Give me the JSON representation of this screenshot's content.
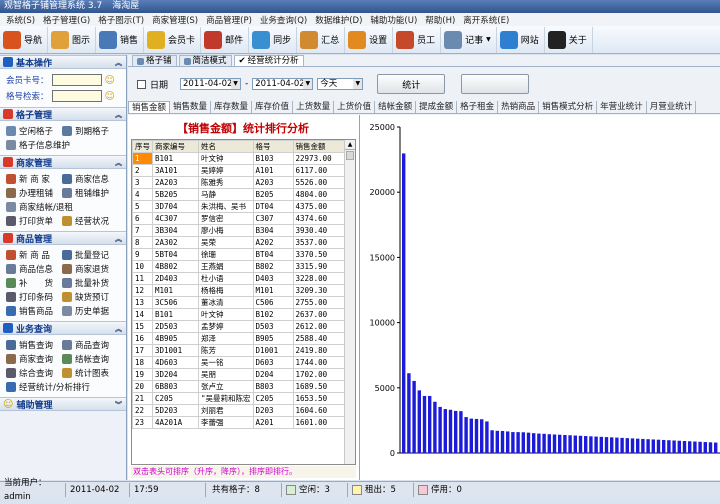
{
  "app": {
    "title": "观智格子铺管理系统 3.7",
    "user": "海淘屋"
  },
  "menu": [
    "系统(S)",
    "格子管理(G)",
    "格子图示(T)",
    "商家管理(S)",
    "商品管理(P)",
    "业务查询(Q)",
    "数据维护(D)",
    "辅助功能(U)",
    "帮助(H)",
    "离开系统(E)"
  ],
  "toolbar": [
    {
      "label": "导航",
      "icon": "home-icon",
      "color": "#d9531e"
    },
    {
      "label": "图示",
      "icon": "grid-icon",
      "color": "#e0a03a"
    },
    {
      "label": "销售",
      "icon": "cash-register-icon",
      "color": "#4a79b8"
    },
    {
      "label": "会员卡",
      "icon": "member-card-icon",
      "color": "#e0b020"
    },
    {
      "label": "邮件",
      "icon": "mail-icon",
      "color": "#c0392b"
    },
    {
      "label": "同步",
      "icon": "sync-icon",
      "color": "#3a8fd0"
    },
    {
      "label": "汇总",
      "icon": "summary-icon",
      "color": "#d08a30"
    },
    {
      "label": "设置",
      "icon": "settings-icon",
      "color": "#e08a20"
    },
    {
      "label": "员工",
      "icon": "staff-icon",
      "color": "#c44a2a"
    },
    {
      "label": "记事",
      "icon": "notes-icon",
      "color": "#6a8ab0"
    },
    {
      "label": "网站",
      "icon": "globe-icon",
      "color": "#2f7fd0"
    },
    {
      "label": "关于",
      "icon": "about-icon",
      "color": "#222222"
    }
  ],
  "sidebar": {
    "basic": {
      "title": "基本操作",
      "member_label": "会员卡号：",
      "grid_label": "格号检索："
    },
    "grid_mgmt": {
      "title": "格子管理",
      "items": [
        "空闲格子",
        "到期格子",
        "格子信息维护"
      ]
    },
    "merchant_mgmt": {
      "title": "商家管理",
      "items": [
        "新 商 家",
        "商家信息",
        "办理租铺",
        "租铺维护",
        "商家结帐/退租",
        "打印货单",
        "经营状况"
      ]
    },
    "product_mgmt": {
      "title": "商品管理",
      "items": [
        "新 商 品",
        "批量登记",
        "商品信息",
        "商家退货",
        "补　　货",
        "批量补货",
        "打印条码",
        "缺货预订",
        "销售商品",
        "历史单据"
      ]
    },
    "query": {
      "title": "业务查询",
      "items": [
        "销售查询",
        "商品查询",
        "商家查询",
        "结帐查询",
        "综合查询",
        "统计图表",
        "经营统计/分析排行"
      ]
    },
    "aux": {
      "title": "辅助管理"
    }
  },
  "tabs_top": [
    "格子铺",
    "简洁模式",
    "经营统计分析"
  ],
  "filter": {
    "date_label": "日期",
    "date_from": "2011-04-02",
    "date_to": "2011-04-02",
    "range": "今天",
    "stat_button": "统计"
  },
  "tabs_stat": [
    "销售金额",
    "销售数量",
    "库存数量",
    "库存价值",
    "上货数量",
    "上货价值",
    "结帐金额",
    "提成金额",
    "格子租金",
    "热销商品",
    "销售模式分析",
    "年营业统计",
    "月营业统计"
  ],
  "report": {
    "title": "【销售金额】统计排行分析",
    "columns": [
      "序号",
      "商家编号",
      "姓名",
      "格号",
      "销售金额"
    ],
    "rows": [
      [
        "1",
        "B101",
        "叶文钟",
        "B103",
        "22973.00"
      ],
      [
        "2",
        "3A101",
        "吴婷婷",
        "A101",
        "6117.00"
      ],
      [
        "3",
        "2A203",
        "陈雅秀",
        "A203",
        "5526.00"
      ],
      [
        "4",
        "5B205",
        "马静",
        "B205",
        "4804.00"
      ],
      [
        "5",
        "3D704",
        "朱洪梅、吴书",
        "DT04",
        "4375.00"
      ],
      [
        "6",
        "4C307",
        "罗信密",
        "C307",
        "4374.60"
      ],
      [
        "7",
        "3B304",
        "廖小梅",
        "B304",
        "3930.40"
      ],
      [
        "8",
        "2A302",
        "吴荣",
        "A202",
        "3537.00"
      ],
      [
        "9",
        "5BT04",
        "徐珊",
        "BT04",
        "3370.50"
      ],
      [
        "10",
        "4B802",
        "王燕娟",
        "B802",
        "3315.90"
      ],
      [
        "11",
        "2D403",
        "杜小语",
        "D403",
        "3228.00"
      ],
      [
        "12",
        "M101",
        "杨格梅",
        "M101",
        "3209.30"
      ],
      [
        "13",
        "3C506",
        "董冰清",
        "C506",
        "2755.00"
      ],
      [
        "14",
        "B101",
        "叶文钟",
        "B102",
        "2637.00"
      ],
      [
        "15",
        "2D503",
        "孟梦婷",
        "D503",
        "2612.00"
      ],
      [
        "16",
        "4B905",
        "郑泽",
        "B905",
        "2588.40"
      ],
      [
        "17",
        "3D1001",
        "陈芳",
        "D1001",
        "2419.80"
      ],
      [
        "18",
        "4D603",
        "吴一铭",
        "D603",
        "1744.00"
      ],
      [
        "19",
        "3D204",
        "吴朋",
        "D204",
        "1702.00"
      ],
      [
        "20",
        "6B803",
        "张卢立",
        "B803",
        "1689.50"
      ],
      [
        "21",
        "C205",
        "\"吴曼莉和陈宏",
        "C205",
        "1653.50"
      ],
      [
        "22",
        "5D203",
        "刘丽君",
        "D203",
        "1604.60"
      ],
      [
        "23",
        "4A201A",
        "李蕾强",
        "A201",
        "1601.00"
      ]
    ],
    "hint": "双击表头可排序（升序，降序），排序即排行。"
  },
  "chart_data": {
    "type": "bar",
    "yticks": [
      "0",
      "5000",
      "10000",
      "15000",
      "20000",
      "25000"
    ],
    "ylim": [
      0,
      25000
    ],
    "values": [
      22973,
      6117,
      5526,
      4804,
      4375,
      4374.6,
      3930.4,
      3537,
      3370.5,
      3315.9,
      3228,
      3209.3,
      2755,
      2637,
      2612,
      2588.4,
      2419.8,
      1744,
      1702,
      1689.5,
      1653.5,
      1604.6,
      1601,
      1590,
      1560,
      1520,
      1490,
      1470,
      1440,
      1420,
      1400,
      1380,
      1360,
      1340,
      1320,
      1300,
      1280,
      1260,
      1240,
      1220,
      1200,
      1180,
      1160,
      1140,
      1120,
      1100,
      1080,
      1060,
      1040,
      1020,
      1000,
      980,
      960,
      940,
      920,
      900,
      880,
      860,
      840,
      820,
      800,
      780
    ],
    "bar_color": "#1c1cd8"
  },
  "status": {
    "user": "当前用户：admin",
    "date": "2011-04-02",
    "time": "17:59",
    "total": "共有格子：8",
    "idle": "空闲：3",
    "rented": "租出：5",
    "stopped": "停用：0"
  }
}
